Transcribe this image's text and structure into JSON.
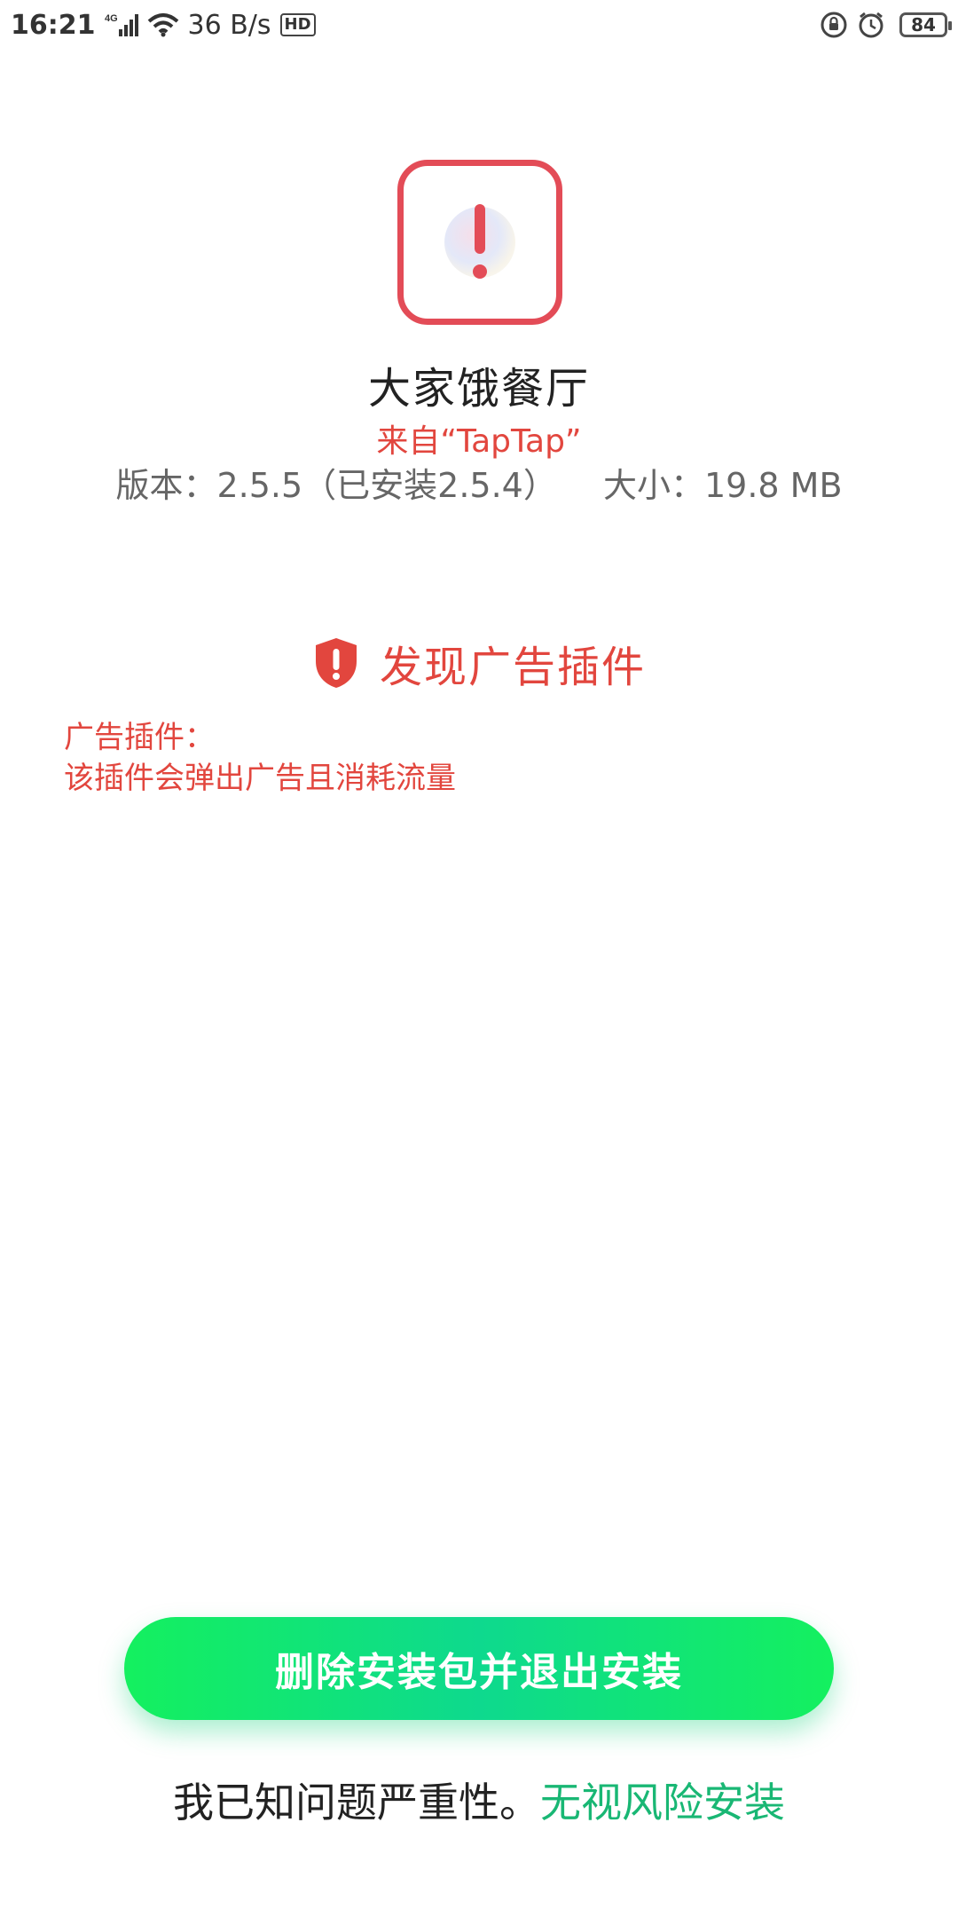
{
  "status_bar": {
    "time": "16:21",
    "network": "4G",
    "speed": "36 B/s",
    "hd": "HD",
    "battery": "84"
  },
  "app": {
    "name": "大家饿餐厅",
    "source": "来自“TapTap”",
    "version": "版本：2.5.5（已安装2.5.4）",
    "size": "大小：19.8 MB",
    "icon_border_color": "#e34c57"
  },
  "warning": {
    "title": "发现广告插件",
    "detail_label": "广告插件：",
    "detail_text": "该插件会弹出广告且消耗流量",
    "color": "#e2463e"
  },
  "actions": {
    "delete_button": "删除安装包并退出安装",
    "ack_text": "我已知问题严重性。",
    "ignore_link": "无视风险安装",
    "accent_color": "#19b774"
  }
}
